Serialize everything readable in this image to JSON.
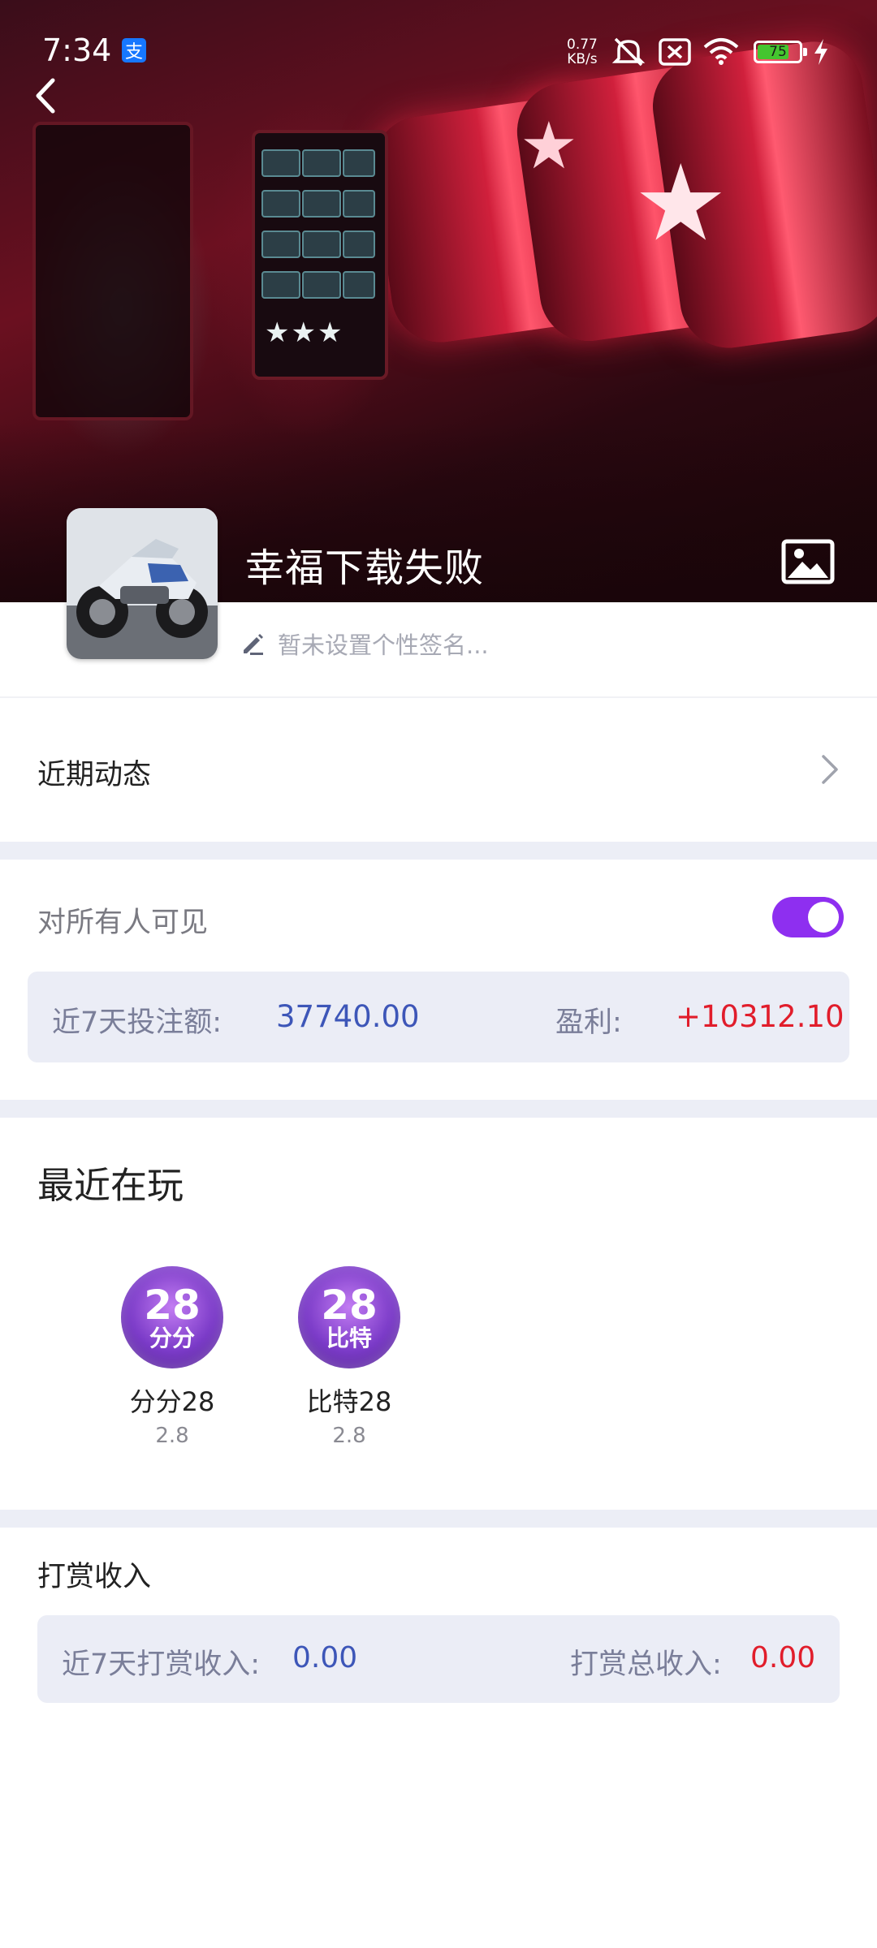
{
  "status_bar": {
    "time": "7:34",
    "alipay_badge": "支",
    "net_speed_value": "0.77",
    "net_speed_unit": "KB/s",
    "battery_level": "75",
    "battery_percent": 75,
    "battery_color": "#45c52f"
  },
  "header": {
    "back_icon": "chevron-left-icon",
    "gallery_icon": "image-icon"
  },
  "profile": {
    "username": "幸福下载失败",
    "signature_placeholder": "暂未设置个性签名...",
    "edit_icon": "pencil-icon"
  },
  "recent_activity": {
    "label": "近期动态"
  },
  "visibility": {
    "label": "对所有人可见",
    "enabled": true,
    "toggle_color": "#8e2ff0"
  },
  "stats": {
    "bet_label": "近7天投注额:",
    "bet_value": "37740.00",
    "profit_label": "盈利:",
    "profit_value": "+10312.10",
    "value_color": "#3d56b8",
    "profit_color": "#e11d2b"
  },
  "recent_games": {
    "title": "最近在玩",
    "items": [
      {
        "name": "分分28",
        "sub": "2.8",
        "icon_number": "28",
        "icon_text": "分分"
      },
      {
        "name": "比特28",
        "sub": "2.8",
        "icon_number": "28",
        "icon_text": "比特"
      }
    ]
  },
  "tips": {
    "title": "打赏收入",
    "recent_label": "近7天打赏收入:",
    "recent_value": "0.00",
    "total_label": "打赏总收入:",
    "total_value": "0.00"
  }
}
